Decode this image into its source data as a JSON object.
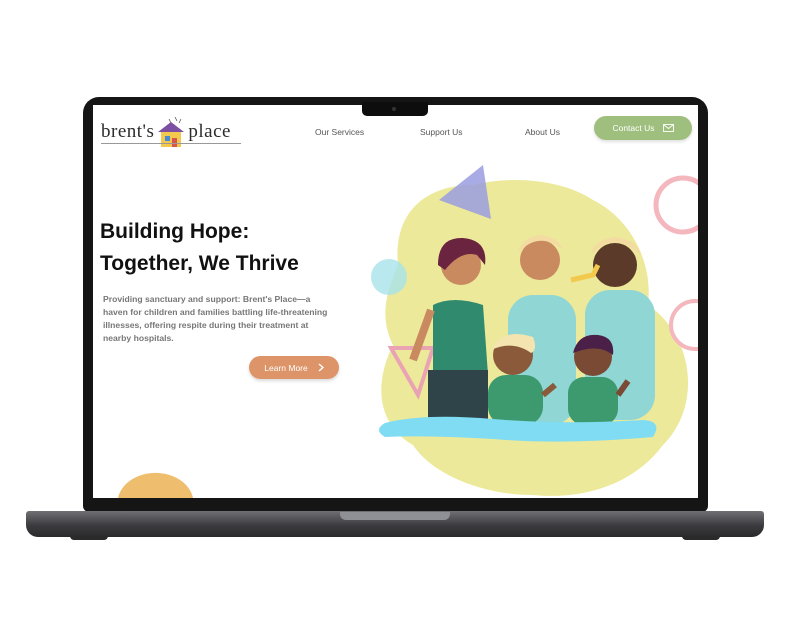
{
  "site": {
    "logo_text_left": "brent's",
    "logo_text_right": "place",
    "logo_icon": "house-icon"
  },
  "nav": {
    "items": [
      {
        "label": "Our Services"
      },
      {
        "label": "Support Us"
      },
      {
        "label": "About Us"
      }
    ],
    "contact_label": "Contact Us",
    "contact_icon": "mail-icon"
  },
  "hero": {
    "title_line1": "Building Hope:",
    "title_line2": "Together, We Thrive",
    "description": "Providing sanctuary and support: Brent's Place—a haven for children and families battling life-threatening illnesses, offering respite during their treatment at nearby hospitals.",
    "cta_label": "Learn More",
    "cta_icon": "chevron-right-icon"
  },
  "colors": {
    "accent_green": "#9fbf7e",
    "cta_orange": "#dd9468",
    "blob_yellow": "#ece99a",
    "wave_blue": "#7fdcf2"
  }
}
